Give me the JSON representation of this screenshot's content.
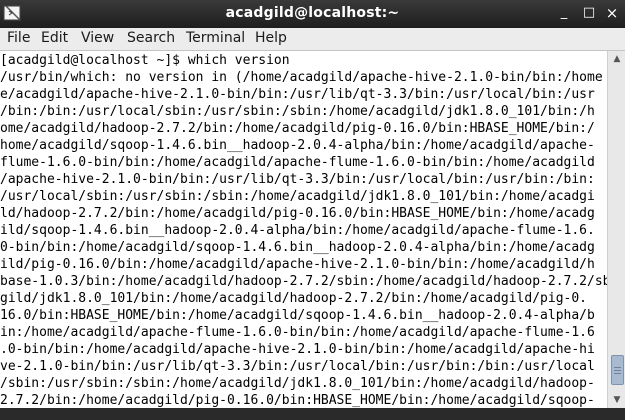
{
  "window": {
    "title": "acadgild@localhost:~",
    "minimize_glyph": "_",
    "maximize_glyph": "□",
    "close_glyph": "×"
  },
  "menu": {
    "items": [
      "File",
      "Edit",
      "View",
      "Search",
      "Terminal",
      "Help"
    ]
  },
  "terminal": {
    "lines": [
      "[acadgild@localhost ~]$ which version",
      "/usr/bin/which: no version in (/home/acadgild/apache-hive-2.1.0-bin/bin:/home",
      "e/acadgild/apache-hive-2.1.0-bin/bin:/usr/lib/qt-3.3/bin:/usr/local/bin:/usr",
      "/bin:/bin:/usr/local/sbin:/usr/sbin:/sbin:/home/acadgild/jdk1.8.0_101/bin:/h",
      "ome/acadgild/hadoop-2.7.2/bin:/home/acadgild/pig-0.16.0/bin:HBASE_HOME/bin:/",
      "home/acadgild/sqoop-1.4.6.bin__hadoop-2.0.4-alpha/bin:/home/acadgild/apache-",
      "flume-1.6.0-bin/bin:/home/acadgild/apache-flume-1.6.0-bin/bin:/home/acadgild",
      "/apache-hive-2.1.0-bin/bin:/usr/lib/qt-3.3/bin:/usr/local/bin:/usr/bin:/bin:",
      "/usr/local/sbin:/usr/sbin:/sbin:/home/acadgild/jdk1.8.0_101/bin:/home/acadgi",
      "ld/hadoop-2.7.2/bin:/home/acadgild/pig-0.16.0/bin:HBASE_HOME/bin:/home/acadg",
      "ild/sqoop-1.4.6.bin__hadoop-2.0.4-alpha/bin:/home/acadgild/apache-flume-1.6.",
      "0-bin/bin:/home/acadgild/sqoop-1.4.6.bin__hadoop-2.0.4-alpha/bin:/home/acadg",
      "ild/pig-0.16.0/bin:/home/acadgild/apache-hive-2.1.0-bin/bin:/home/acadgild/h",
      "base-1.0.3/bin:/home/acadgild/hadoop-2.7.2/sbin:/home/acadgild/hadoop-2.7.2/sbin:/home/acad",
      "gild/jdk1.8.0_101/bin:/home/acadgild/hadoop-2.7.2/bin:/home/acadgild/pig-0.",
      "16.0/bin:HBASE_HOME/bin:/home/acadgild/sqoop-1.4.6.bin__hadoop-2.0.4-alpha/b",
      "in:/home/acadgild/apache-flume-1.6.0-bin/bin:/home/acadgild/apache-flume-1.6",
      ".0-bin/bin:/home/acadgild/apache-hive-2.1.0-bin/bin:/home/acadgild/apache-hi",
      "ve-2.1.0-bin/bin:/usr/lib/qt-3.3/bin:/usr/local/bin:/usr/bin:/bin:/usr/local",
      "/sbin:/usr/sbin:/sbin:/home/acadgild/jdk1.8.0_101/bin:/home/acadgild/hadoop-",
      "2.7.2/bin:/home/acadgild/pig-0.16.0/bin:HBASE_HOME/bin:/home/acadgild/sqoop-"
    ]
  },
  "scrollbar": {
    "up_arrow": "▲",
    "down_arrow": "▼"
  }
}
